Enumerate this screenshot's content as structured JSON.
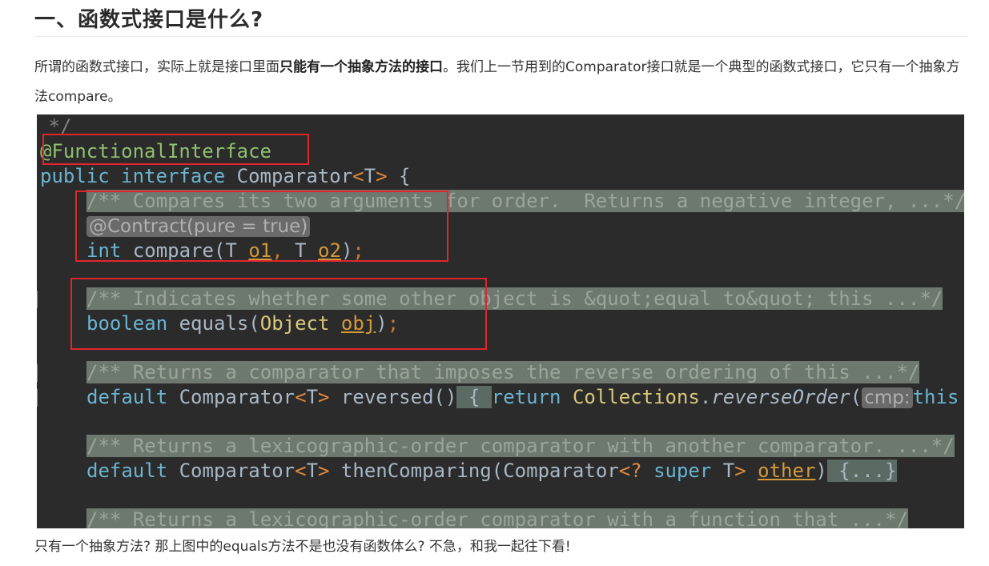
{
  "heading": "一、函数式接口是什么?",
  "para": {
    "part1": "所谓的函数式接口，实际上就是接口里面",
    "bold": "只能有一个抽象方法的接口",
    "part2": "。我们上一节用到的Comparator接口就是一个典型的函数式接口，它只有一个抽象方法compare。"
  },
  "code": {
    "l0": " */",
    "annotation": "@FunctionalInterface",
    "public": "public",
    "interface": "interface",
    "comparator": "Comparator",
    "lt": "<",
    "T": "T",
    "gt": ">",
    "brace": " {",
    "doc_compare": "/** Compares its two arguments for order.  Returns a negative integer, ...*/",
    "contract": "@Contract(pure = true)",
    "int": "int",
    "compare": " compare(T ",
    "o1": "o1",
    "comma": ",",
    "T2": " T ",
    "o2": "o2",
    "close_paren": ")",
    "semi": ";",
    "doc_equals": "/** Indicates whether some other object is &quot;equal to&quot; this ...*/",
    "boolean": "boolean",
    "equals": " equals(",
    "object": "Object",
    "obj": "obj",
    "doc_reversed": "/** Returns a comparator that imposes the reverse ordering of this ...*/",
    "default": "default",
    "reversed": " reversed()",
    "open_brace": " { ",
    "return": "return",
    "collections": "Collections",
    "dot": ".",
    "reverseOrder": "reverseOrder",
    "open_paren": "(",
    "cmp": "cmp:",
    "this": "this",
    "doc_thencomparing": "/** Returns a lexicographic-order comparator with another comparator. ...*/",
    "thenComparing": " thenComparing(",
    "wildcard": "? ",
    "super": "super",
    "other": "other",
    "folded_body": " {...}",
    "doc_function": "/** Returns a lexicographic-order comparator with a function that ...*/"
  },
  "bottom": "只有一个抽象方法? 那上图中的equals方法不是也没有函数体么? 不急，和我一起往下看!"
}
